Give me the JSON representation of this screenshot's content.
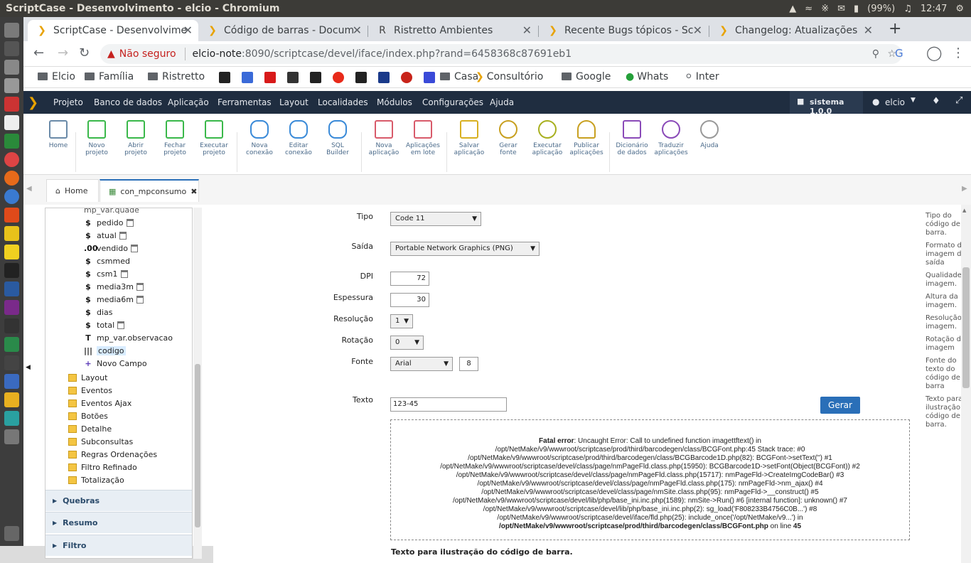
{
  "os": {
    "window_title": "ScriptCase - Desenvolvimento - elcio - Chromium",
    "battery": "(99%)",
    "clock": "12:47"
  },
  "browser": {
    "tabs": [
      {
        "label": "ScriptCase - Desenvolvime"
      },
      {
        "label": "Código de barras - Docum"
      },
      {
        "label": "Ristretto Ambientes"
      },
      {
        "label": "Recente Bugs tópicos - Sc"
      },
      {
        "label": "Changelog: Atualizações"
      }
    ],
    "new_tab": "+",
    "security_label": "Não seguro",
    "url_host": "elcio-note",
    "url_path": ":8090/scriptcase/devel/iface/index.php?rand=6458368c87691eb1",
    "bookmarks": [
      "Elcio",
      "Família",
      "Ristretto",
      "Casa",
      "Consultório",
      "Google",
      "Whats",
      "Inter"
    ]
  },
  "menu": {
    "items": [
      "Projeto",
      "Banco de dados",
      "Aplicação",
      "Ferramentas",
      "Layout",
      "Localidades",
      "Módulos",
      "Configurações",
      "Ajuda"
    ],
    "project": "sistema 1.0.0",
    "user": "elcio"
  },
  "toolbar": {
    "buttons": [
      {
        "l1": "Home",
        "l2": ""
      },
      {
        "l1": "Novo",
        "l2": "projeto"
      },
      {
        "l1": "Abrir",
        "l2": "projeto"
      },
      {
        "l1": "Fechar",
        "l2": "projeto"
      },
      {
        "l1": "Executar",
        "l2": "projeto"
      },
      {
        "l1": "Nova",
        "l2": "conexão"
      },
      {
        "l1": "Editar",
        "l2": "conexão"
      },
      {
        "l1": "SQL",
        "l2": "Builder"
      },
      {
        "l1": "Nova",
        "l2": "aplicação"
      },
      {
        "l1": "Aplicações",
        "l2": "em lote"
      },
      {
        "l1": "Salvar",
        "l2": "aplicação"
      },
      {
        "l1": "Gerar",
        "l2": "fonte"
      },
      {
        "l1": "Executar",
        "l2": "aplicação"
      },
      {
        "l1": "Publicar",
        "l2": "aplicações"
      },
      {
        "l1": "Dicionário",
        "l2": "de dados"
      },
      {
        "l1": "Traduzir",
        "l2": "aplicações"
      },
      {
        "l1": "Ajuda",
        "l2": ""
      }
    ]
  },
  "page_tabs": {
    "home": "Home",
    "current": "con_mpconsumo"
  },
  "sidebar": {
    "partial_top": "mp_var.quade",
    "fields": [
      {
        "icon": "$",
        "label": "pedido",
        "del": true
      },
      {
        "icon": "$",
        "label": "atual",
        "del": true
      },
      {
        "icon": ".00",
        "label": "vendido",
        "del": true
      },
      {
        "icon": "$",
        "label": "csmmed",
        "del": false
      },
      {
        "icon": "$",
        "label": "csm1",
        "del": true
      },
      {
        "icon": "$",
        "label": "media3m",
        "del": true
      },
      {
        "icon": "$",
        "label": "media6m",
        "del": true
      },
      {
        "icon": "$",
        "label": "dias",
        "del": false
      },
      {
        "icon": "$",
        "label": "total",
        "del": true
      },
      {
        "icon": "T",
        "label": "mp_var.observacao",
        "del": false
      },
      {
        "icon": "|||",
        "label": "codigo",
        "del": false
      },
      {
        "icon": "+",
        "label": "Novo Campo",
        "del": false
      }
    ],
    "folders": [
      "Layout",
      "Eventos",
      "Eventos Ajax",
      "Botões",
      "Detalhe",
      "Subconsultas",
      "Regras Ordenações",
      "Filtro Refinado",
      "Totalização"
    ],
    "sections": [
      "Quebras",
      "Resumo",
      "Filtro"
    ]
  },
  "form": {
    "tipo": {
      "label": "Tipo",
      "value": "Code 11",
      "hint": "Tipo do código de barra."
    },
    "saida": {
      "label": "Saída",
      "value": "Portable Network Graphics (PNG)",
      "hint": "Formato de imagem de saída"
    },
    "dpi": {
      "label": "DPI",
      "value": "72",
      "hint": "Qualidade da imagem."
    },
    "espessura": {
      "label": "Espessura",
      "value": "30",
      "hint": "Altura da imagem."
    },
    "resolucao": {
      "label": "Resolução",
      "value": "1",
      "hint": "Resolução da imagem."
    },
    "rotacao": {
      "label": "Rotação",
      "value": "0",
      "hint": "Rotação da imagem"
    },
    "fonte": {
      "label": "Fonte",
      "value": "Arial",
      "size": "8",
      "hint": "Fonte do texto do código de barra"
    },
    "texto": {
      "label": "Texto",
      "value": "123-45",
      "hint": "Texto para ilustração do código de barra."
    },
    "gerar": "Gerar",
    "error": {
      "title": "Fatal error",
      "lines": [
        ": Uncaught Error: Call to undefined function imagettftext() in",
        "/opt/NetMake/v9/wwwroot/scriptcase/prod/third/barcodegen/class/BCGFont.php:45 Stack trace: #0",
        "/opt/NetMake/v9/wwwroot/scriptcase/prod/third/barcodegen/class/BCGBarcode1D.php(82): BCGFont->setText('') #1",
        "/opt/NetMake/v9/wwwroot/scriptcase/devel/class/page/nmPageFld.class.php(15950): BCGBarcode1D->setFont(Object(BCGFont)) #2",
        "/opt/NetMake/v9/wwwroot/scriptcase/devel/class/page/nmPageFld.class.php(15717): nmPageFld->CreateImgCodeBar() #3",
        "/opt/NetMake/v9/wwwroot/scriptcase/devel/class/page/nmPageFld.class.php(175): nmPageFld->nm_ajax() #4",
        "/opt/NetMake/v9/wwwroot/scriptcase/devel/class/page/nmSite.class.php(95): nmPageFld->__construct() #5",
        "/opt/NetMake/v9/wwwroot/scriptcase/devel/lib/php/base_ini.inc.php(1589): nmSite->Run() #6 [internal function]: unknown() #7",
        "/opt/NetMake/v9/wwwroot/scriptcase/devel/lib/php/base_ini.inc.php(2): sg_load('F808233B4756C0B...') #8",
        "/opt/NetMake/v9/wwwroot/scriptcase/devel/iface/fld.php(25): include_once('/opt/NetMake/v9...') in"
      ],
      "file": "/opt/NetMake/v9/wwwroot/scriptcase/prod/third/barcodegen/class/BCGFont.php",
      "online": "on line",
      "line": "45"
    },
    "caption": "Texto para ilustração do código de barra."
  }
}
